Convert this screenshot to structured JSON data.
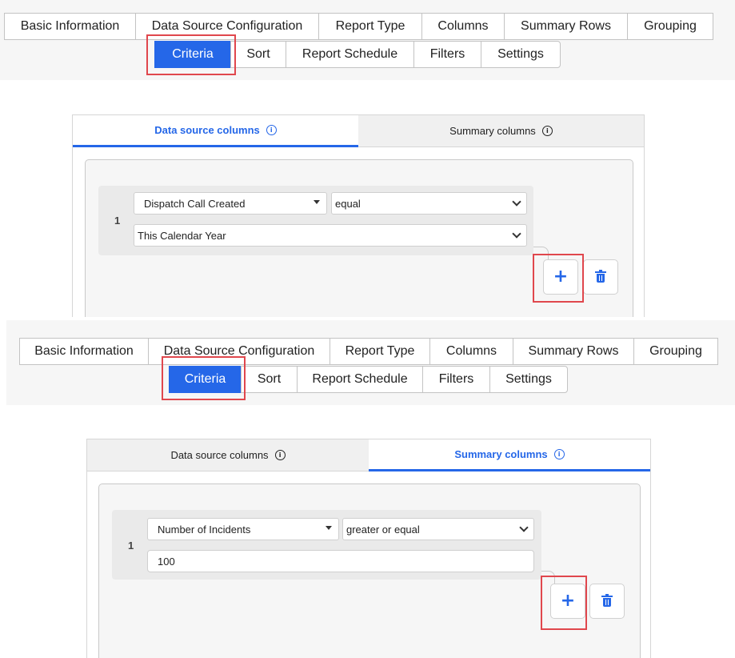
{
  "panels": [
    {
      "main_tabs_row1": [
        "Basic Information",
        "Data Source Configuration",
        "Report Type",
        "Columns",
        "Summary Rows",
        "Grouping"
      ],
      "main_tabs_row2": [
        "Criteria",
        "Sort",
        "Report Schedule",
        "Filters",
        "Settings"
      ],
      "active_main_tab": "Criteria",
      "card_tabs": [
        "Data source columns",
        "Summary columns"
      ],
      "active_card_tab": "Data source columns",
      "rule": {
        "number": "1",
        "field": "Dispatch Call Created",
        "operator": "equal",
        "value": "This Calendar Year",
        "value_kind": "select"
      }
    },
    {
      "main_tabs_row1": [
        "Basic Information",
        "Data Source Configuration",
        "Report Type",
        "Columns",
        "Summary Rows",
        "Grouping"
      ],
      "main_tabs_row2": [
        "Criteria",
        "Sort",
        "Report Schedule",
        "Filters",
        "Settings"
      ],
      "active_main_tab": "Criteria",
      "card_tabs": [
        "Data source columns",
        "Summary columns"
      ],
      "active_card_tab": "Summary columns",
      "rule": {
        "number": "1",
        "field": "Number of Incidents",
        "operator": "greater or equal",
        "value": "100",
        "value_kind": "input"
      }
    }
  ],
  "icons": {
    "add": "plus-icon",
    "delete": "trash-icon",
    "info": "info-icon",
    "dropdown": "caret-down-icon"
  },
  "colors": {
    "accent": "#2567e8",
    "highlight": "#e0474d"
  }
}
